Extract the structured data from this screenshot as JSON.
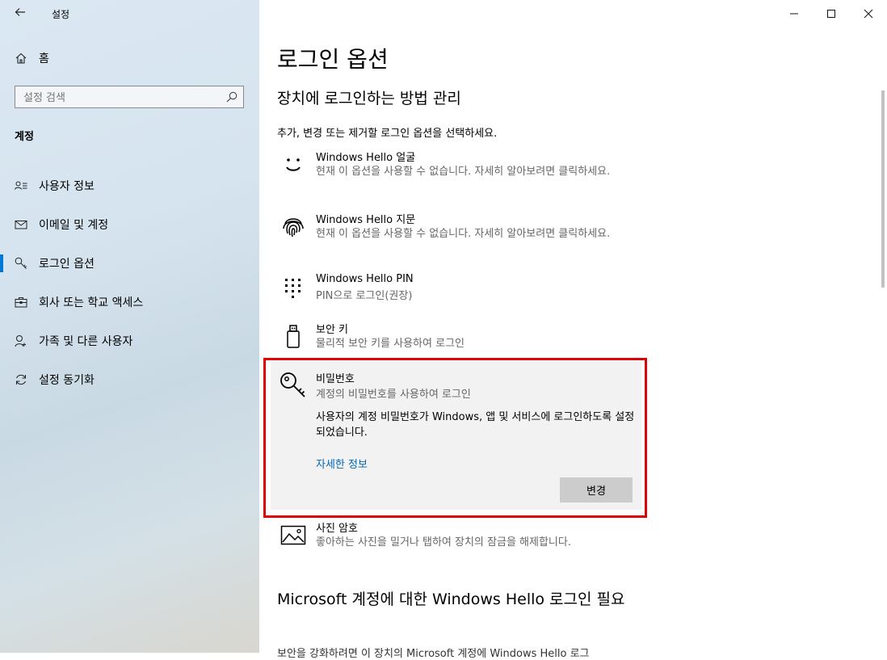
{
  "app": {
    "title": "설정"
  },
  "sidebar": {
    "home_label": "홈",
    "search_placeholder": "설정 검색",
    "section_label": "계정",
    "items": [
      {
        "label": "사용자 정보",
        "icon": "user-card-icon",
        "active": false
      },
      {
        "label": "이메일 및 계정",
        "icon": "mail-icon",
        "active": false
      },
      {
        "label": "로그인 옵션",
        "icon": "key-icon",
        "active": true
      },
      {
        "label": "회사 또는 학교 액세스",
        "icon": "briefcase-icon",
        "active": false
      },
      {
        "label": "가족 및 다른 사용자",
        "icon": "person-add-icon",
        "active": false
      },
      {
        "label": "설정 동기화",
        "icon": "sync-icon",
        "active": false
      }
    ]
  },
  "main": {
    "title": "로그인 옵션",
    "subtitle": "장치에 로그인하는 방법 관리",
    "description": "추가, 변경 또는 제거할 로그인 옵션을 선택하세요.",
    "options": [
      {
        "title": "Windows Hello 얼굴",
        "subtitle": "현재 이 옵션을 사용할 수 없습니다. 자세히 알아보려면 클릭하세요.",
        "icon": "smile-face-icon"
      },
      {
        "title": "Windows Hello 지문",
        "subtitle": "현재 이 옵션을 사용할 수 없습니다. 자세히 알아보려면 클릭하세요.",
        "icon": "fingerprint-icon"
      },
      {
        "title": "Windows Hello PIN",
        "subtitle": "PIN으로 로그인(권장)",
        "icon": "keypad-icon"
      },
      {
        "title": "보안 키",
        "subtitle": "물리적 보안 키를 사용하여 로그인",
        "icon": "usb-key-icon"
      }
    ],
    "password": {
      "title": "비밀번호",
      "subtitle": "계정의 비밀번호를 사용하여 로그인",
      "body": "사용자의 계정 비밀번호가 Windows, 앱 및 서비스에 로그인하도록 설정되었습니다.",
      "link": "자세한 정보",
      "button": "변경"
    },
    "picture": {
      "title": "사진 암호",
      "subtitle": "좋아하는 사진을 밀거나 탭하여 장치의 잠금을 해제합니다.",
      "icon": "picture-icon"
    },
    "section2_title": "Microsoft 계정에 대한 Windows Hello 로그인 필요",
    "section2_text": "보안을 강화하려면 이 장치의 Microsoft 계정에 Windows Hello 로그"
  },
  "colors": {
    "accent": "#0078d7",
    "link": "#0067b8",
    "highlight": "#e00000"
  }
}
